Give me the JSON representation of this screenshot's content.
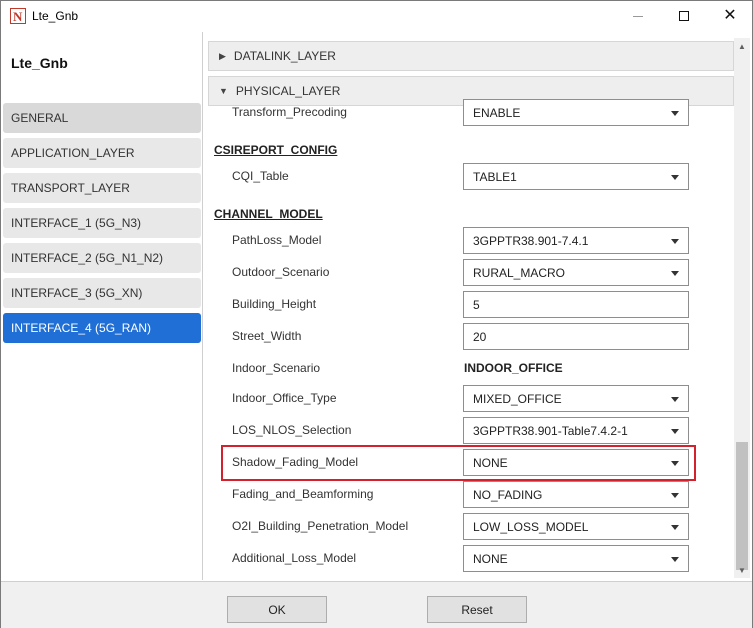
{
  "window": {
    "title": "Lte_Gnb",
    "app_icon_glyph": "N",
    "controls": {
      "minimize": "minimize-icon",
      "maximize": "maximize-icon",
      "close": "close-icon"
    }
  },
  "sidebar": {
    "device_title": "Lte_Gnb",
    "items": [
      {
        "label": "GENERAL",
        "state": "highlighted"
      },
      {
        "label": "APPLICATION_LAYER",
        "state": "normal"
      },
      {
        "label": "TRANSPORT_LAYER",
        "state": "normal"
      },
      {
        "label": "INTERFACE_1 (5G_N3)",
        "state": "normal"
      },
      {
        "label": "INTERFACE_2 (5G_N1_N2)",
        "state": "normal"
      },
      {
        "label": "INTERFACE_3 (5G_XN)",
        "state": "normal"
      },
      {
        "label": "INTERFACE_4 (5G_RAN)",
        "state": "selected"
      }
    ]
  },
  "sections": {
    "datalink": {
      "label": "DATALINK_LAYER",
      "expanded": false
    },
    "physical": {
      "label": "PHYSICAL_LAYER",
      "expanded": true
    }
  },
  "form": {
    "transform_precoding": {
      "label": "Transform_Precoding",
      "value": "ENABLE"
    },
    "csireport_group": "CSIREPORT_CONFIG",
    "cqi_table": {
      "label": "CQI_Table",
      "value": "TABLE1"
    },
    "channel_model_group": "CHANNEL_MODEL",
    "pathloss_model": {
      "label": "PathLoss_Model",
      "value": "3GPPTR38.901-7.4.1"
    },
    "outdoor_scenario": {
      "label": "Outdoor_Scenario",
      "value": "RURAL_MACRO"
    },
    "building_height": {
      "label": "Building_Height",
      "value": "5"
    },
    "street_width": {
      "label": "Street_Width",
      "value": "20"
    },
    "indoor_scenario": {
      "label": "Indoor_Scenario",
      "value": "INDOOR_OFFICE"
    },
    "indoor_office_type": {
      "label": "Indoor_Office_Type",
      "value": "MIXED_OFFICE"
    },
    "los_nlos_selection": {
      "label": "LOS_NLOS_Selection",
      "value": "3GPPTR38.901-Table7.4.2-1"
    },
    "shadow_fading_model": {
      "label": "Shadow_Fading_Model",
      "value": "NONE"
    },
    "fading_and_beamforming": {
      "label": "Fading_and_Beamforming",
      "value": "NO_FADING"
    },
    "o2i_building_penetration": {
      "label": "O2I_Building_Penetration_Model",
      "value": "LOW_LOSS_MODEL"
    },
    "additional_loss_model": {
      "label": "Additional_Loss_Model",
      "value": "NONE"
    }
  },
  "buttons": {
    "ok": "OK",
    "reset": "Reset"
  },
  "colors": {
    "accent": "#1f6fd6",
    "highlight_border": "#d3212d",
    "app_icon": "#c0392b"
  }
}
